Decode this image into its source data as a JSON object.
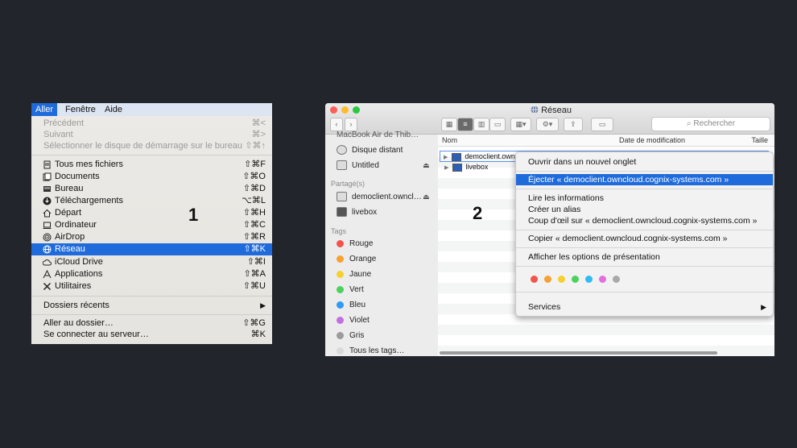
{
  "panel1": {
    "menubar": [
      "Aller",
      "Fenêtre",
      "Aide"
    ],
    "disabled": [
      {
        "label": "Précédent",
        "shortcut": "⌘<"
      },
      {
        "label": "Suivant",
        "shortcut": "⌘>"
      },
      {
        "label": "Sélectionner le disque de démarrage sur le bureau",
        "shortcut": "⇧⌘↑"
      }
    ],
    "places": [
      {
        "label": "Tous mes fichiers",
        "shortcut": "⇧⌘F",
        "icon": "all-files-icon"
      },
      {
        "label": "Documents",
        "shortcut": "⇧⌘O",
        "icon": "documents-icon"
      },
      {
        "label": "Bureau",
        "shortcut": "⇧⌘D",
        "icon": "desktop-icon"
      },
      {
        "label": "Téléchargements",
        "shortcut": "⌥⌘L",
        "icon": "downloads-icon"
      },
      {
        "label": "Départ",
        "shortcut": "⇧⌘H",
        "icon": "home-icon"
      },
      {
        "label": "Ordinateur",
        "shortcut": "⇧⌘C",
        "icon": "computer-icon"
      },
      {
        "label": "AirDrop",
        "shortcut": "⇧⌘R",
        "icon": "airdrop-icon"
      },
      {
        "label": "Réseau",
        "shortcut": "⇧⌘K",
        "icon": "network-icon"
      },
      {
        "label": "iCloud Drive",
        "shortcut": "⇧⌘I",
        "icon": "cloud-icon"
      },
      {
        "label": "Applications",
        "shortcut": "⇧⌘A",
        "icon": "applications-icon"
      },
      {
        "label": "Utilitaires",
        "shortcut": "⇧⌘U",
        "icon": "utilities-icon"
      }
    ],
    "recent": {
      "label": "Dossiers récents",
      "arrow": "▶"
    },
    "goto": [
      {
        "label": "Aller au dossier…",
        "shortcut": "⇧⌘G"
      },
      {
        "label": "Se connecter au serveur…",
        "shortcut": "⌘K"
      }
    ],
    "step": "1"
  },
  "panel2": {
    "window_title": "Réseau",
    "search_placeholder": "Rechercher",
    "sidebar": {
      "partial_top": "MacBook Air de Thib…",
      "devices": [
        {
          "label": "Disque distant"
        },
        {
          "label": "Untitled",
          "eject": "⏏"
        }
      ],
      "shared_header": "Partagé(s)",
      "shared": [
        {
          "label": "democlient.owncl…",
          "eject": "⏏"
        },
        {
          "label": "livebox"
        }
      ],
      "tags_header": "Tags",
      "tags": [
        {
          "label": "Rouge",
          "color": "#f3534b"
        },
        {
          "label": "Orange",
          "color": "#f7a132"
        },
        {
          "label": "Jaune",
          "color": "#f6cf30"
        },
        {
          "label": "Vert",
          "color": "#4bd25a"
        },
        {
          "label": "Bleu",
          "color": "#2f9bf3"
        },
        {
          "label": "Violet",
          "color": "#c46fe0"
        },
        {
          "label": "Gris",
          "color": "#9b9b9b"
        },
        {
          "label": "Tous les tags…",
          "color": "#d9d9d9"
        }
      ]
    },
    "columns": [
      "Nom",
      "Date de modification",
      "Taille"
    ],
    "rows": [
      "democlient.owncloud.cognix-systems.com",
      "livebox"
    ],
    "step": "2"
  },
  "context_menu": {
    "open_tab": "Ouvrir dans un nouvel onglet",
    "eject": "Éjecter « democlient.owncloud.cognix-systems.com »",
    "get_info": "Lire les informations",
    "make_alias": "Créer un alias",
    "quicklook": "Coup d'œil sur « democlient.owncloud.cognix-systems.com »",
    "copy": "Copier « democlient.owncloud.cognix-systems.com »",
    "view_options": "Afficher les options de présentation",
    "tag_colors": [
      "#f3534b",
      "#f7a132",
      "#f6cf30",
      "#4bd25a",
      "#2fbcf3",
      "#e070de",
      "#a9a9a9"
    ],
    "services": "Services",
    "services_arrow": "▶"
  }
}
